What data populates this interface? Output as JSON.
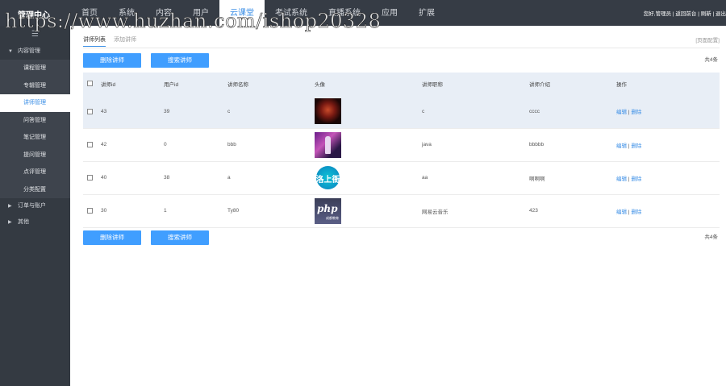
{
  "watermark": "https://www.huzhan.com/ishop20328",
  "header": {
    "brand": "管理中心",
    "nav": [
      "首页",
      "系统",
      "内容",
      "用户",
      "云课堂",
      "考试系统",
      "直播系统",
      "应用",
      "扩展"
    ],
    "active_nav": "云课堂",
    "right_text": "您好,管理员 | 返回前台 | 刷新 | 退出"
  },
  "sidebar": {
    "toggle": "☰",
    "groups": [
      {
        "label": "内容管理",
        "expanded": true
      },
      {
        "label": "订单与账户",
        "expanded": false
      },
      {
        "label": "其他",
        "expanded": false
      }
    ],
    "items": [
      "课程管理",
      "专辑管理",
      "讲师管理",
      "问答管理",
      "笔记管理",
      "提问管理",
      "点评管理",
      "分类配置"
    ],
    "active_item": "讲师管理"
  },
  "main": {
    "tabs": [
      "讲师列表",
      "添加讲师"
    ],
    "page_config": "[页面配置]",
    "delete_btn": "删除讲师",
    "search_btn": "搜索讲师",
    "total": "共4条",
    "columns": [
      "讲师id",
      "用户id",
      "讲师名称",
      "头像",
      "讲师职称",
      "讲师介绍",
      "操作"
    ],
    "rows": [
      {
        "id": "43",
        "uid": "39",
        "name": "c",
        "avatar": "dark-red-portrait",
        "title": "c",
        "intro": "cccc",
        "edit": "编辑",
        "sep": "|",
        "del": "删除"
      },
      {
        "id": "42",
        "uid": "0",
        "name": "bbb",
        "avatar": "purple-stage-performer",
        "title": "java",
        "intro": "bbbbb",
        "edit": "编辑",
        "sep": "|",
        "del": "删除"
      },
      {
        "id": "40",
        "uid": "38",
        "name": "a",
        "avatar": "blue-circle-logo",
        "avatar_text": "洛上衙",
        "title": "aa",
        "intro": "啊啊啊",
        "edit": "编辑",
        "sep": "|",
        "del": "删除"
      },
      {
        "id": "30",
        "uid": "1",
        "name": "Ty80",
        "avatar": "php-logo",
        "avatar_text": "php",
        "avatar_sub": "成都教育",
        "title": "网易云音乐",
        "intro": "423",
        "edit": "编辑",
        "sep": "|",
        "del": "删除"
      }
    ]
  },
  "colors": {
    "topbar": "#363c45",
    "sidebar": "#343a42",
    "accent": "#409eff",
    "highlight_row": "#e8eef6"
  }
}
